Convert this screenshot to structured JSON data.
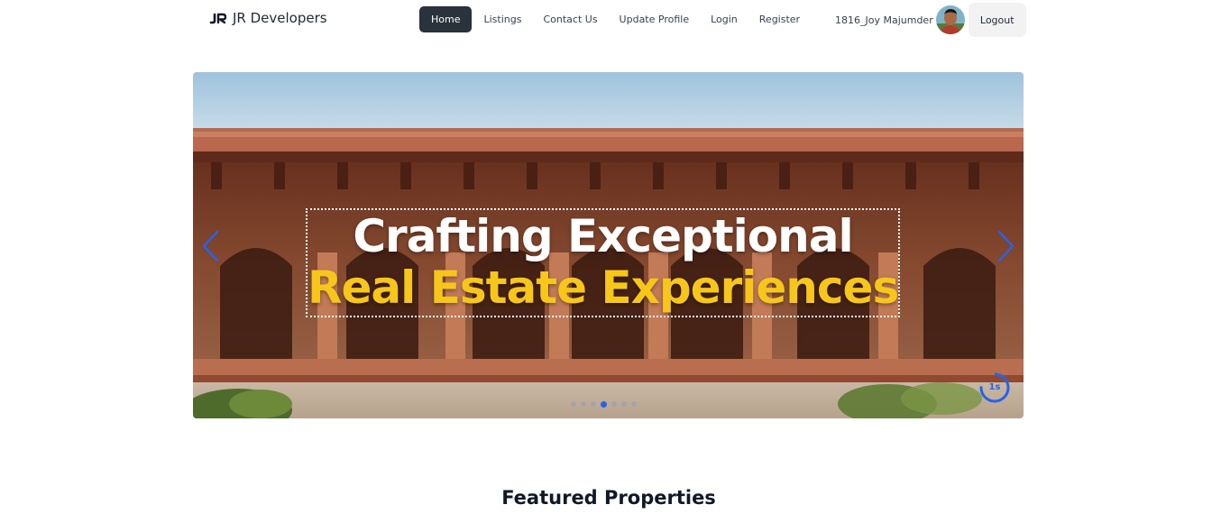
{
  "navbar": {
    "brand_name": "JR Developers",
    "brand_logo_text": "JR",
    "links": [
      {
        "label": "Home",
        "active": true
      },
      {
        "label": "Listings",
        "active": false
      },
      {
        "label": "Contact Us",
        "active": false
      },
      {
        "label": "Update Profile",
        "active": false
      },
      {
        "label": "Login",
        "active": false
      },
      {
        "label": "Register",
        "active": false
      }
    ],
    "username": "1816_Joy Majumder",
    "logout_label": "Logout"
  },
  "hero": {
    "headline_line1": "Crafting Exceptional",
    "headline_line2": "Real Estate Experiences",
    "slide_count": 7,
    "active_slide": 4,
    "timer_value": "1s",
    "colors": {
      "headline_primary": "#ffffff",
      "headline_accent": "#f7c61a",
      "control_accent": "#2563eb"
    }
  },
  "featured": {
    "title": "Featured Properties"
  }
}
